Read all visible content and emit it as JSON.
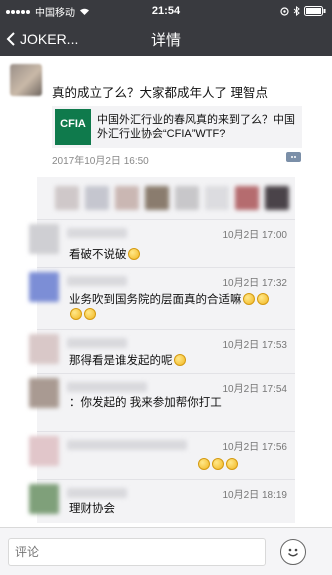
{
  "status_bar": {
    "carrier": "中国移动",
    "time": "21:54"
  },
  "nav": {
    "back_label": "JOKER...",
    "title": "详情"
  },
  "post": {
    "text": "真的成立了么？大家都成年人了 理智点",
    "link": {
      "logo_text": "CFIA",
      "title": "中国外汇行业的春风真的来到了么？中国外汇行业协会“CFIA”WTF?"
    },
    "timestamp": "2017年10月2日 16:50"
  },
  "comments": [
    {
      "time": "10月2日 17:00",
      "text": "看破不说破",
      "emoji_count": 1
    },
    {
      "time": "10月2日 17:32",
      "text": "业务吹到国务院的层面真的合适嘛",
      "emoji_count": 4
    },
    {
      "time": "10月2日 17:53",
      "text": "那得看是谁发起的呢",
      "emoji_count": 1
    },
    {
      "time": "10月2日 17:54",
      "text": "：你发起的 我来参加帮你打工",
      "emoji_count": 0
    },
    {
      "time": "10月2日 17:56",
      "text": "",
      "emoji_count": 3
    },
    {
      "time": "10月2日 18:19",
      "text": "理财协会",
      "emoji_count": 0
    }
  ],
  "input": {
    "placeholder": "评论"
  },
  "colors": {
    "header_bg": "#393a3f",
    "comment_bg": "#f3f3f5",
    "logo_green": "#0f7a4c"
  }
}
